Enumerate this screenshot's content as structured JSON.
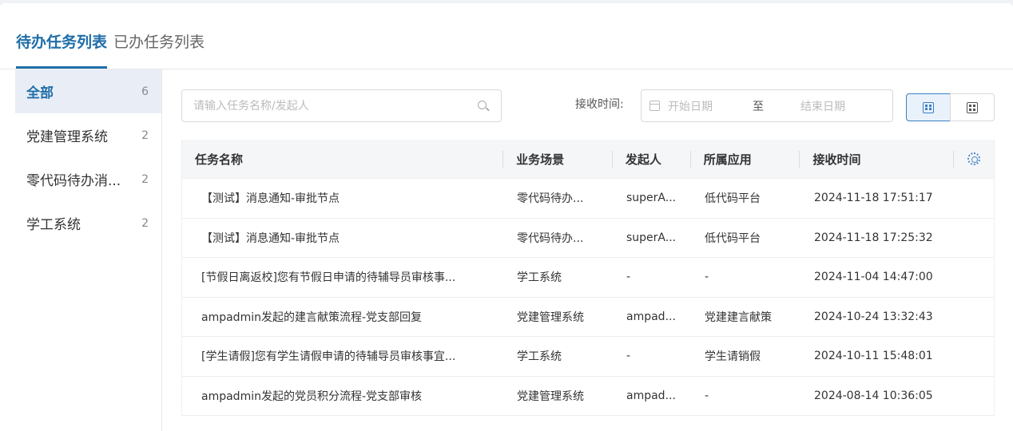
{
  "tabs": [
    {
      "label": "待办任务列表",
      "active": true
    },
    {
      "label": "已办任务列表",
      "active": false
    }
  ],
  "sidebar": {
    "items": [
      {
        "label": "全部",
        "count": "6",
        "active": true
      },
      {
        "label": "党建管理系统",
        "count": "2",
        "active": false
      },
      {
        "label": "零代码待办消...",
        "count": "2",
        "active": false
      },
      {
        "label": "学工系统",
        "count": "2",
        "active": false
      }
    ]
  },
  "search": {
    "placeholder": "请输入任务名称/发起人",
    "value": ""
  },
  "filter": {
    "time_label": "接收时间:",
    "start_placeholder": "开始日期",
    "separator": "至",
    "end_placeholder": "结束日期"
  },
  "table": {
    "headers": [
      "任务名称",
      "业务场景",
      "发起人",
      "所属应用",
      "接收时间"
    ],
    "rows": [
      [
        "【测试】消息通知-审批节点",
        "零代码待办...",
        "superA...",
        "低代码平台",
        "2024-11-18 17:51:17"
      ],
      [
        "【测试】消息通知-审批节点",
        "零代码待办...",
        "superA...",
        "低代码平台",
        "2024-11-18 17:25:32"
      ],
      [
        "[节假日离返校]您有节假日申请的待辅导员审核事...",
        "学工系统",
        "-",
        "-",
        "2024-11-04 14:47:00"
      ],
      [
        "ampadmin发起的建言献策流程-党支部回复",
        "党建管理系统",
        "ampad...",
        "党建建言献策",
        "2024-10-24 13:32:43"
      ],
      [
        "[学生请假]您有学生请假申请的待辅导员审核事宜...",
        "学工系统",
        "-",
        "学生请销假",
        "2024-10-11 15:48:01"
      ],
      [
        "ampadmin发起的党员积分流程-党支部审核",
        "党建管理系统",
        "ampad...",
        "-",
        "2024-08-14 10:36:05"
      ]
    ]
  },
  "colors": {
    "accent": "#1f6ea8",
    "active_bg": "#e9eef6",
    "header_bg": "#f5f6f8"
  },
  "icons": {
    "search": "search-icon",
    "calendar": "calendar-icon",
    "list_view": "list-view-icon",
    "grid_view": "grid-view-icon",
    "settings": "gear-icon"
  }
}
